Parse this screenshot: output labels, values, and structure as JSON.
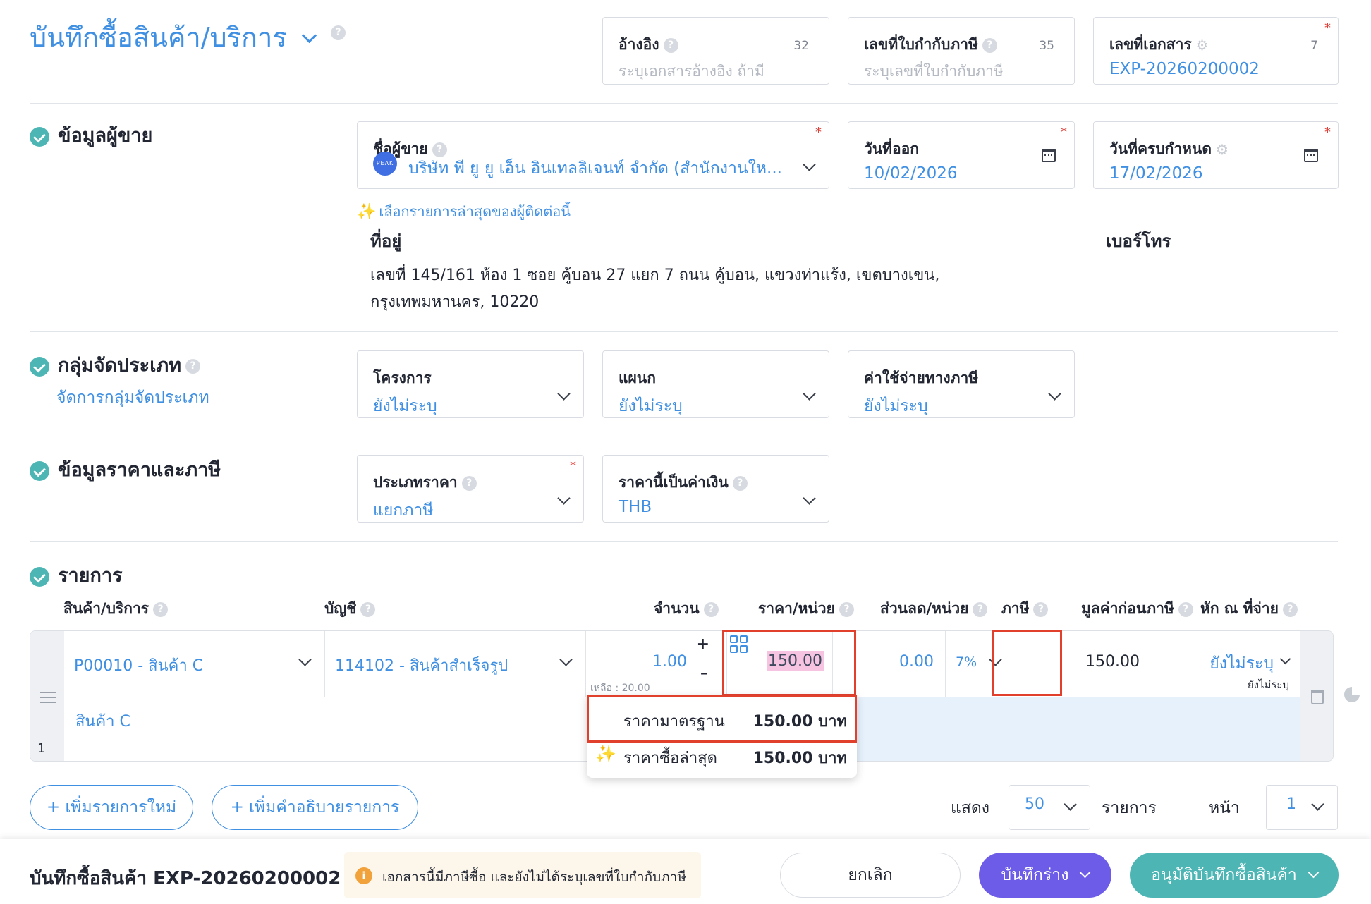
{
  "header": {
    "title": "บันทึกซื้อสินค้า/บริการ",
    "reference": {
      "label": "อ้างอิง",
      "count": "32",
      "placeholder": "ระบุเอกสารอ้างอิง ถ้ามี"
    },
    "tax_invoice_no": {
      "label": "เลขที่ใบกำกับภาษี",
      "count": "35",
      "placeholder": "ระบุเลขที่ใบกำกับภาษี"
    },
    "doc_no": {
      "label": "เลขที่เอกสาร",
      "count": "7",
      "value": "EXP-20260200002",
      "required": "*"
    }
  },
  "vendor": {
    "section_title": "ข้อมูลผู้ขาย",
    "name_label": "ชื่อผู้ขาย",
    "name_value": "บริษัท พี ยู ยู เอ็น อินเทลลิเจนท์ จำกัด (สำนักงานให...",
    "logo_text": "PEAK",
    "issue_date_label": "วันที่ออก",
    "issue_date": "10/02/2026",
    "due_date_label": "วันที่ครบกำหนด",
    "due_date": "17/02/2026",
    "recent_link": "เลือกรายการล่าสุดของผู้ติดต่อนี้",
    "address_label": "ที่อยู่",
    "address_line1": "เลขที่ 145/161 ห้อง 1 ซอย คู้บอน 27 แยก 7 ถนน คู้บอน, แขวงท่าแร้ง, เขตบางเขน,",
    "address_line2": "กรุงเทพมหานคร, 10220",
    "phone_label": "เบอร์โทร",
    "required": "*"
  },
  "classification": {
    "section_title": "กลุ่มจัดประเภท",
    "manage_link": "จัดการกลุ่มจัดประเภท",
    "project_label": "โครงการ",
    "project_value": "ยังไม่ระบุ",
    "dept_label": "แผนก",
    "dept_value": "ยังไม่ระบุ",
    "tax_exp_label": "ค่าใช้จ่ายทางภาษี",
    "tax_exp_value": "ยังไม่ระบุ"
  },
  "pricing": {
    "section_title": "ข้อมูลราคาและภาษี",
    "price_type_label": "ประเภทราคา",
    "price_type_value": "แยกภาษี",
    "currency_label": "ราคานี้เป็นค่าเงิน",
    "currency_value": "THB",
    "required": "*"
  },
  "items": {
    "section_title": "รายการ",
    "columns": [
      "สินค้า/บริการ",
      "บัญชี",
      "จำนวน",
      "ราคา/หน่วย",
      "ส่วนลด/หน่วย",
      "ภาษี",
      "มูลค่าก่อนภาษี",
      "หัก ณ ที่จ่าย"
    ],
    "row": {
      "product": "P00010 - สินค้า C",
      "account": "114102 - สินค้าสำเร็จรูป",
      "qty": "1.00",
      "remaining": "เหลือ : 20.00",
      "unit_price": "150.00",
      "discount": "0.00",
      "tax": "7%",
      "pre_tax": "150.00",
      "wht": "ยังไม่ระบุ",
      "wht_sub": "ยังไม่ระบุ",
      "description": "สินค้า C",
      "index": "1"
    },
    "price_popup": {
      "standard_label": "ราคามาตรฐาน",
      "standard_value": "150.00 บาท",
      "last_label": "ราคาซื้อล่าสุด",
      "last_value": "150.00 บาท"
    },
    "add_item": "+ เพิ่มรายการใหม่",
    "add_desc": "+ เพิ่มคำอธิบายรายการ",
    "show_label": "แสดง",
    "page_size": "50",
    "items_label": "รายการ",
    "page_label": "หน้า",
    "page_value": "1"
  },
  "footer": {
    "doc_title": "บันทึกซื้อสินค้า EXP-20260200002",
    "warning": "เอกสารนี้มีภาษีซื้อ และยังไม่ได้ระบุเลขที่ใบกำกับภาษี",
    "cancel": "ยกเลิก",
    "save_draft": "บันทึกร่าง",
    "approve": "อนุมัติบันทึกซื้อสินค้า"
  },
  "colors": {
    "accent": "#3f8fe2",
    "draft_button": "#6c5ce7",
    "approve_button": "#4db6b5",
    "highlight": "#e0402c"
  }
}
